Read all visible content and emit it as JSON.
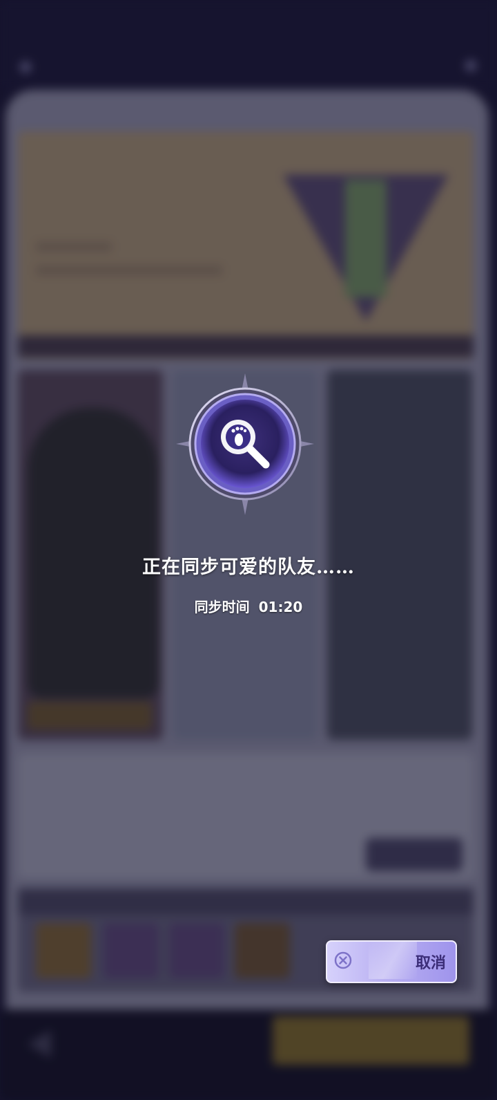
{
  "loading": {
    "message": "正在同步可爱的队友……",
    "timer_label": "同步时间",
    "timer_value": "01:20"
  },
  "cancel_button": {
    "label": "取消"
  },
  "colors": {
    "accent_purple": "#7b67e0",
    "button_text": "#3b2d77",
    "button_fill": "#b9b0f2"
  },
  "icons": {
    "loading": "magnifier-footprint-icon",
    "cancel": "close-circle-icon",
    "back": "back-arrow-icon"
  }
}
